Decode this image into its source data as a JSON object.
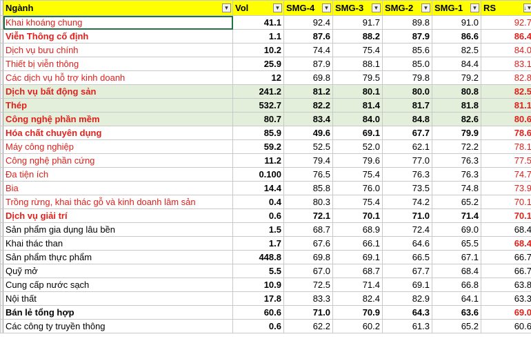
{
  "headers": [
    {
      "label": "Ngành",
      "filter": "▼"
    },
    {
      "label": "Vol",
      "filter": "▼"
    },
    {
      "label": "SMG-4",
      "filter": "▼"
    },
    {
      "label": "SMG-3",
      "filter": "▼"
    },
    {
      "label": "SMG-2",
      "filter": "▼"
    },
    {
      "label": "SMG-1",
      "filter": "▼"
    },
    {
      "label": "RS",
      "filter": "↓▼"
    }
  ],
  "colors": {
    "header_bg": "#ffff00",
    "highlight_bg": "#e3efda",
    "red_text": "#e0201b",
    "selection": "#217346"
  },
  "rows": [
    {
      "name": "Khai khoáng chung",
      "vol": "41.1",
      "smg4": "92.4",
      "smg3": "91.7",
      "smg2": "89.8",
      "smg1": "91.0",
      "rs": "92.7",
      "name_red": true,
      "name_bold": false,
      "data_bold": false,
      "rs_red": true,
      "highlight": false
    },
    {
      "name": "Viễn Thông cố định",
      "vol": "1.1",
      "smg4": "87.6",
      "smg3": "88.2",
      "smg2": "87.9",
      "smg1": "86.6",
      "rs": "86.4",
      "name_red": true,
      "name_bold": true,
      "data_bold": true,
      "rs_red": true,
      "highlight": false
    },
    {
      "name": "Dịch vụ bưu chính",
      "vol": "10.2",
      "smg4": "74.4",
      "smg3": "75.4",
      "smg2": "85.6",
      "smg1": "82.5",
      "rs": "84.0",
      "name_red": true,
      "name_bold": false,
      "data_bold": false,
      "rs_red": true,
      "highlight": false
    },
    {
      "name": "Thiết bị viễn thông",
      "vol": "25.9",
      "smg4": "87.9",
      "smg3": "88.1",
      "smg2": "85.0",
      "smg1": "84.4",
      "rs": "83.1",
      "name_red": true,
      "name_bold": false,
      "data_bold": false,
      "rs_red": true,
      "highlight": false
    },
    {
      "name": "Các dịch vụ hỗ trợ kinh doanh",
      "vol": "12",
      "smg4": "69.8",
      "smg3": "79.5",
      "smg2": "79.8",
      "smg1": "79.2",
      "rs": "82.8",
      "name_red": true,
      "name_bold": false,
      "data_bold": false,
      "rs_red": true,
      "highlight": false
    },
    {
      "name": "Dịch vụ bất động sản",
      "vol": "241.2",
      "smg4": "81.2",
      "smg3": "80.1",
      "smg2": "80.0",
      "smg1": "80.8",
      "rs": "82.5",
      "name_red": true,
      "name_bold": true,
      "data_bold": true,
      "rs_red": true,
      "highlight": true
    },
    {
      "name": "Thép",
      "vol": "532.7",
      "smg4": "82.2",
      "smg3": "81.4",
      "smg2": "81.7",
      "smg1": "81.8",
      "rs": "81.1",
      "name_red": true,
      "name_bold": true,
      "data_bold": true,
      "rs_red": true,
      "highlight": true
    },
    {
      "name": "Công nghệ phần mềm",
      "vol": "80.7",
      "smg4": "83.4",
      "smg3": "84.0",
      "smg2": "84.8",
      "smg1": "82.6",
      "rs": "80.6",
      "name_red": true,
      "name_bold": true,
      "data_bold": true,
      "rs_red": true,
      "highlight": true
    },
    {
      "name": "Hóa chất chuyên dụng",
      "vol": "85.9",
      "smg4": "49.6",
      "smg3": "69.1",
      "smg2": "67.7",
      "smg1": "79.9",
      "rs": "78.6",
      "name_red": true,
      "name_bold": true,
      "data_bold": true,
      "rs_red": true,
      "highlight": false
    },
    {
      "name": "Máy công nghiệp",
      "vol": "59.2",
      "smg4": "52.5",
      "smg3": "52.0",
      "smg2": "62.1",
      "smg1": "72.2",
      "rs": "78.1",
      "name_red": true,
      "name_bold": false,
      "data_bold": false,
      "rs_red": true,
      "highlight": false
    },
    {
      "name": "Công nghệ phần cứng",
      "vol": "11.2",
      "smg4": "79.4",
      "smg3": "79.6",
      "smg2": "77.0",
      "smg1": "76.3",
      "rs": "77.5",
      "name_red": true,
      "name_bold": false,
      "data_bold": false,
      "rs_red": true,
      "highlight": false
    },
    {
      "name": "Đa tiện ích",
      "vol": "0.100",
      "smg4": "76.5",
      "smg3": "75.4",
      "smg2": "76.3",
      "smg1": "76.3",
      "rs": "74.7",
      "name_red": true,
      "name_bold": false,
      "data_bold": false,
      "rs_red": true,
      "highlight": false
    },
    {
      "name": "Bia",
      "vol": "14.4",
      "smg4": "85.8",
      "smg3": "76.0",
      "smg2": "73.5",
      "smg1": "74.8",
      "rs": "73.9",
      "name_red": true,
      "name_bold": false,
      "data_bold": false,
      "rs_red": true,
      "highlight": false
    },
    {
      "name": "Trồng rừng, khai thác gỗ và kinh doanh lâm sản",
      "vol": "0.4",
      "smg4": "80.3",
      "smg3": "75.4",
      "smg2": "74.2",
      "smg1": "65.2",
      "rs": "70.1",
      "name_red": true,
      "name_bold": false,
      "data_bold": false,
      "rs_red": true,
      "highlight": false
    },
    {
      "name": "Dịch vụ giải trí",
      "vol": "0.6",
      "smg4": "72.1",
      "smg3": "70.1",
      "smg2": "71.0",
      "smg1": "71.4",
      "rs": "70.1",
      "name_red": true,
      "name_bold": true,
      "data_bold": true,
      "rs_red": true,
      "highlight": false
    },
    {
      "name": "Sản phẩm gia dụng lâu bền",
      "vol": "1.5",
      "smg4": "68.7",
      "smg3": "68.9",
      "smg2": "72.4",
      "smg1": "69.0",
      "rs": "68.4",
      "name_red": false,
      "name_bold": false,
      "data_bold": false,
      "rs_red": false,
      "highlight": false
    },
    {
      "name": "Khai thác than",
      "vol": "1.7",
      "smg4": "67.6",
      "smg3": "66.1",
      "smg2": "64.6",
      "smg1": "65.5",
      "rs": "68.4",
      "name_red": false,
      "name_bold": false,
      "data_bold": false,
      "rs_red": true,
      "rs_bold": true,
      "highlight": false
    },
    {
      "name": "Sản phẩm thực phẩm",
      "vol": "448.8",
      "smg4": "69.8",
      "smg3": "69.1",
      "smg2": "66.5",
      "smg1": "67.1",
      "rs": "66.7",
      "name_red": false,
      "name_bold": false,
      "data_bold": false,
      "rs_red": false,
      "highlight": false
    },
    {
      "name": "Quỹ mở",
      "vol": "5.5",
      "smg4": "67.0",
      "smg3": "68.7",
      "smg2": "67.7",
      "smg1": "68.4",
      "rs": "66.7",
      "name_red": false,
      "name_bold": false,
      "data_bold": false,
      "rs_red": false,
      "highlight": false
    },
    {
      "name": "Cung cấp nước sạch",
      "vol": "10.9",
      "smg4": "72.5",
      "smg3": "71.4",
      "smg2": "69.1",
      "smg1": "66.8",
      "rs": "63.8",
      "name_red": false,
      "name_bold": false,
      "data_bold": false,
      "rs_red": false,
      "highlight": false
    },
    {
      "name": "Nội thất",
      "vol": "17.8",
      "smg4": "83.3",
      "smg3": "82.4",
      "smg2": "82.9",
      "smg1": "64.1",
      "rs": "63.3",
      "name_red": false,
      "name_bold": false,
      "data_bold": false,
      "rs_red": false,
      "highlight": false
    },
    {
      "name": "Bán lẻ tổng hợp",
      "vol": "60.6",
      "smg4": "71.0",
      "smg3": "70.9",
      "smg2": "64.3",
      "smg1": "63.6",
      "rs": "69.0",
      "name_red": false,
      "name_bold": true,
      "data_bold": true,
      "rs_red": true,
      "highlight": false
    },
    {
      "name": "Các công ty truyền thông",
      "vol": "0.6",
      "smg4": "62.2",
      "smg3": "60.2",
      "smg2": "61.3",
      "smg1": "65.2",
      "rs": "60.6",
      "name_red": false,
      "name_bold": false,
      "data_bold": false,
      "rs_red": false,
      "highlight": false
    }
  ]
}
